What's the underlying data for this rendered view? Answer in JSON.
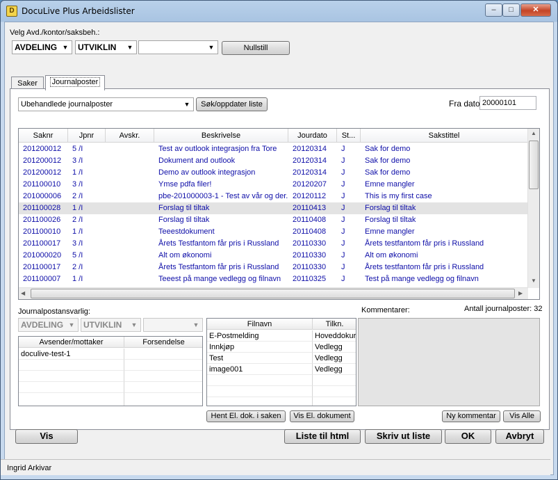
{
  "window": {
    "title": "DocuLive Plus Arbeidslister",
    "icon_letter": "D",
    "buttons": {
      "minimize": "–",
      "maximize": "□",
      "close": "✕"
    }
  },
  "filter": {
    "label": "Velg Avd./kontor/saksbeh.:",
    "department": "AVDELING",
    "office": "UTVIKLIN",
    "handler": "",
    "reset_button": "Nullstill"
  },
  "tabs": [
    {
      "label": "Saker",
      "active": false
    },
    {
      "label": "Journalposter",
      "active": true
    }
  ],
  "list_controls": {
    "list_type": "Ubehandlede journalposter",
    "search_button": "Søk/oppdater liste",
    "from_date_label": "Fra dato:",
    "from_date_value": "20000101"
  },
  "grid": {
    "columns": [
      "Saknr",
      "Jpnr",
      "Avskr.",
      "Beskrivelse",
      "Jourdato",
      "St...",
      "Sakstittel"
    ],
    "rows": [
      {
        "saknr": "201200012",
        "jpnr": "5 /I",
        "avskr": "",
        "beskrivelse": "Test av outlook integrasjon fra Tore",
        "jourdato": "20120314",
        "status": "J",
        "sakstittel": "Sak for demo",
        "selected": false
      },
      {
        "saknr": "201200012",
        "jpnr": "3 /I",
        "avskr": "",
        "beskrivelse": "Dokument and outlook",
        "jourdato": "20120314",
        "status": "J",
        "sakstittel": "Sak for demo",
        "selected": false
      },
      {
        "saknr": "201200012",
        "jpnr": "1 /I",
        "avskr": "",
        "beskrivelse": "Demo av outlook integrasjon",
        "jourdato": "20120314",
        "status": "J",
        "sakstittel": "Sak for demo",
        "selected": false
      },
      {
        "saknr": "201100010",
        "jpnr": "3 /I",
        "avskr": "",
        "beskrivelse": "Ymse pdfa filer!",
        "jourdato": "20120207",
        "status": "J",
        "sakstittel": "Emne mangler",
        "selected": false
      },
      {
        "saknr": "201000006",
        "jpnr": "2 /I",
        "avskr": "",
        "beskrivelse": "pbe-201000003-1 - Test av vår og der...",
        "jourdato": "20120112",
        "status": "J",
        "sakstittel": "This is my first case",
        "selected": false
      },
      {
        "saknr": "201100028",
        "jpnr": "1 /I",
        "avskr": "",
        "beskrivelse": "Forslag til tiltak",
        "jourdato": "20110413",
        "status": "J",
        "sakstittel": "Forslag til tiltak",
        "selected": true
      },
      {
        "saknr": "201100026",
        "jpnr": "2 /I",
        "avskr": "",
        "beskrivelse": "Forslag til tiltak",
        "jourdato": "20110408",
        "status": "J",
        "sakstittel": "Forslag til tiltak",
        "selected": false
      },
      {
        "saknr": "201100010",
        "jpnr": "1 /I",
        "avskr": "",
        "beskrivelse": "Teeestdokument",
        "jourdato": "20110408",
        "status": "J",
        "sakstittel": "Emne mangler",
        "selected": false
      },
      {
        "saknr": "201100017",
        "jpnr": "3 /I",
        "avskr": "",
        "beskrivelse": "Årets Testfantom får pris i Russland",
        "jourdato": "20110330",
        "status": "J",
        "sakstittel": "Årets testfantom får pris i Russland",
        "selected": false
      },
      {
        "saknr": "201000020",
        "jpnr": "5 /I",
        "avskr": "",
        "beskrivelse": "Alt om økonomi",
        "jourdato": "20110330",
        "status": "J",
        "sakstittel": "Alt om økonomi",
        "selected": false
      },
      {
        "saknr": "201100017",
        "jpnr": "2 /I",
        "avskr": "",
        "beskrivelse": "Årets Testfantom får pris i Russland",
        "jourdato": "20110330",
        "status": "J",
        "sakstittel": "Årets testfantom får pris i Russland",
        "selected": false
      },
      {
        "saknr": "201100007",
        "jpnr": "1 /I",
        "avskr": "",
        "beskrivelse": "Teeest på mange vedlegg og filnavn",
        "jourdato": "20110325",
        "status": "J",
        "sakstittel": "Test på mange vedlegg og filnavn",
        "selected": false
      }
    ]
  },
  "responsible": {
    "label": "Journalpostansvarlig:",
    "department": "AVDELING",
    "office": "UTVIKLIN",
    "handler": ""
  },
  "senders": {
    "columns": [
      "Avsender/mottaker",
      "Forsendelse"
    ],
    "rows": [
      {
        "name": "doculive-test-1",
        "shipment": ""
      }
    ]
  },
  "files": {
    "columns": [
      "Filnavn",
      "Tilkn."
    ],
    "rows": [
      {
        "name": "E-Postmelding",
        "link": "Hoveddokur"
      },
      {
        "name": "Innkjøp",
        "link": "Vedlegg"
      },
      {
        "name": "Test",
        "link": "Vedlegg"
      },
      {
        "name": "image001",
        "link": "Vedlegg"
      }
    ],
    "fetch_button": "Hent El. dok. i saken",
    "show_button": "Vis El. dokument"
  },
  "comments": {
    "label": "Kommentarer:",
    "count_text": "Antall journalposter: 32",
    "new_button": "Ny kommentar",
    "show_all_button": "Vis Alle"
  },
  "footer": {
    "show_button": "Vis",
    "html_button": "Liste til html",
    "print_button": "Skriv ut liste",
    "ok_button": "OK",
    "cancel_button": "Avbryt",
    "status_user": "Ingrid Arkivar"
  }
}
